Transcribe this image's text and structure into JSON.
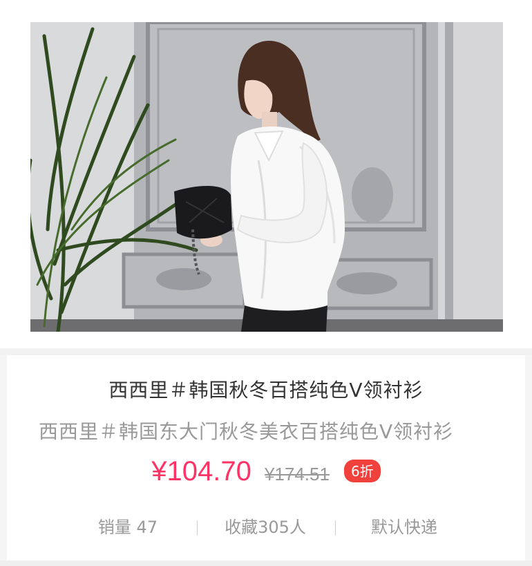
{
  "product": {
    "title": "西西里＃韩国秋冬百搭纯色V领衬衫",
    "subtitle": "西西里＃韩国东大门秋冬美衣百搭纯色V领衬衫",
    "price": "¥104.70",
    "original_price": "¥174.51",
    "discount": "6折",
    "image_icon": "product-photo-woman-white-shirt"
  },
  "stats": {
    "sales": "销量 47",
    "favorites": "收藏305人",
    "shipping": "默认快递"
  },
  "colors": {
    "price": "#ff3366",
    "discount_badge": "#f0413d",
    "title": "#333333",
    "muted": "#999999"
  }
}
